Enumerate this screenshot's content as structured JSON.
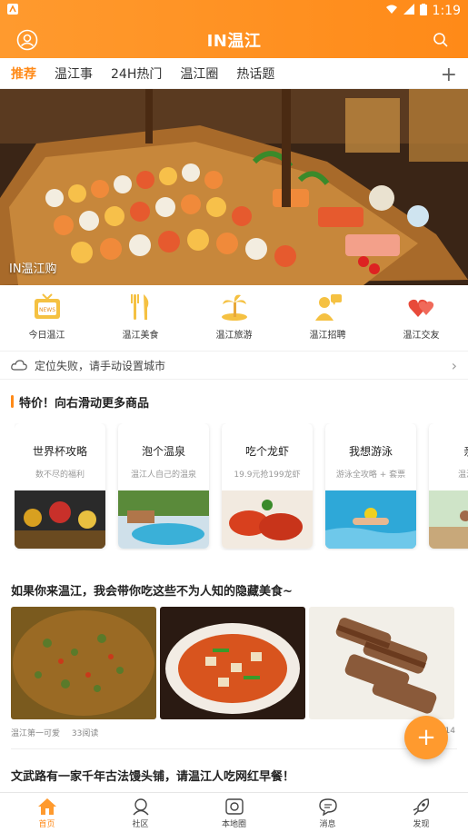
{
  "status_bar": {
    "time": "1:19"
  },
  "header": {
    "title": "IN温江"
  },
  "tabs": [
    {
      "label": "推荐",
      "active": true
    },
    {
      "label": "温江事"
    },
    {
      "label": "24H热门"
    },
    {
      "label": "温江圈"
    },
    {
      "label": "热话题"
    }
  ],
  "banner": {
    "caption": "IN温江购"
  },
  "categories": [
    {
      "label": "今日温江",
      "icon": "tv-news-icon"
    },
    {
      "label": "温江美食",
      "icon": "fork-knife-icon"
    },
    {
      "label": "温江旅游",
      "icon": "palm-island-icon"
    },
    {
      "label": "温江招聘",
      "icon": "job-person-icon"
    },
    {
      "label": "温江交友",
      "icon": "hearts-icon"
    }
  ],
  "location": {
    "text": "定位失败，请手动设置城市"
  },
  "section": {
    "title": "特价！向右滑动更多商品"
  },
  "cards": [
    {
      "title": "世界杯攻略",
      "subtitle": "数不尽的福利"
    },
    {
      "title": "泡个温泉",
      "subtitle": "温江人自己的温泉"
    },
    {
      "title": "吃个龙虾",
      "subtitle": "19.9元抢199龙虾"
    },
    {
      "title": "我想游泳",
      "subtitle": "游泳全攻略 + 套票"
    },
    {
      "title": "亲子",
      "subtitle": "温江首处"
    }
  ],
  "article1": {
    "title": "如果你来温江，我会带你吃这些不为人知的隐藏美食~",
    "author": "温江第一可爱",
    "reads": "33阅读",
    "right_meta": "14"
  },
  "article2": {
    "title": "文武路有一家千年古法馒头铺，请温江人吃网红早餐！"
  },
  "bottom_nav": [
    {
      "label": "首页",
      "active": true
    },
    {
      "label": "社区"
    },
    {
      "label": "本地圈"
    },
    {
      "label": "消息"
    },
    {
      "label": "发现"
    }
  ],
  "colors": {
    "accent": "#ff8a18",
    "header": "#ff9a2e"
  }
}
